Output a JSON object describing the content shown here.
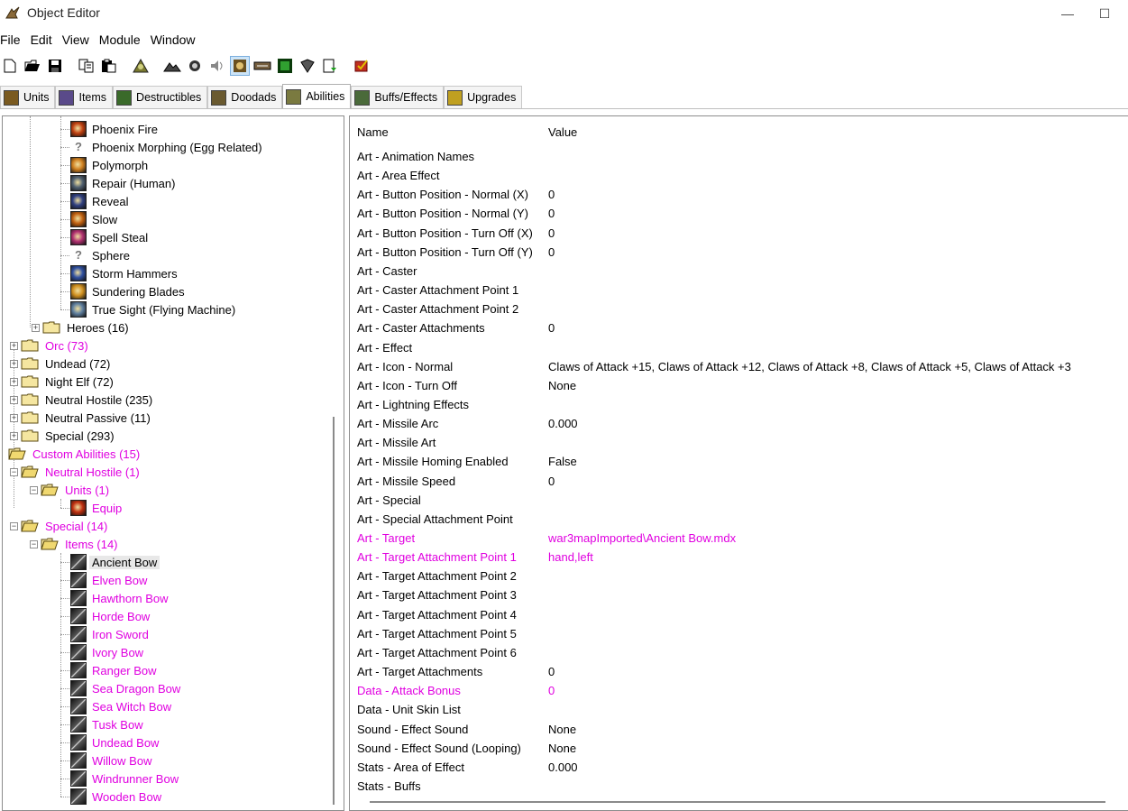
{
  "window": {
    "title": "Object Editor",
    "minimize": "—",
    "maximize": "☐"
  },
  "menu": [
    "File",
    "Edit",
    "View",
    "Module",
    "Window"
  ],
  "tabs": [
    {
      "label": "Units",
      "color": "#7a5a20"
    },
    {
      "label": "Items",
      "color": "#5a4a8a"
    },
    {
      "label": "Destructibles",
      "color": "#3a6a2a"
    },
    {
      "label": "Doodads",
      "color": "#6a5a30"
    },
    {
      "label": "Abilities",
      "color": "#7a7a40",
      "active": true
    },
    {
      "label": "Buffs/Effects",
      "color": "#4a6a3a"
    },
    {
      "label": "Upgrades",
      "color": "#c0a020"
    }
  ],
  "tree": {
    "human_leaves": [
      {
        "label": "Phoenix Fire",
        "icon": "#c04010"
      },
      {
        "label": "Phoenix Morphing (Egg Related)",
        "icon": "query"
      },
      {
        "label": "Polymorph",
        "icon": "#d08020"
      },
      {
        "label": "Repair (Human)",
        "icon": "#506070"
      },
      {
        "label": "Reveal",
        "icon": "#304080"
      },
      {
        "label": "Slow",
        "icon": "#c06010"
      },
      {
        "label": "Spell Steal",
        "icon": "#b03070"
      },
      {
        "label": "Sphere",
        "icon": "query"
      },
      {
        "label": "Storm Hammers",
        "icon": "#3050a0"
      },
      {
        "label": "Sundering Blades",
        "icon": "#d09020"
      },
      {
        "label": "True Sight (Flying Machine)",
        "icon": "#6080a0"
      }
    ],
    "heroes": "Heroes (16)",
    "races": [
      {
        "label": "Orc (73)",
        "modified": true
      },
      {
        "label": "Undead (72)",
        "modified": false
      },
      {
        "label": "Night Elf (72)",
        "modified": false
      },
      {
        "label": "Neutral Hostile (235)",
        "modified": false
      },
      {
        "label": "Neutral Passive (11)",
        "modified": false
      },
      {
        "label": "Special (293)",
        "modified": false
      }
    ],
    "custom_root": "Custom Abilities (15)",
    "custom_neutral": "Neutral Hostile (1)",
    "custom_units": "Units (1)",
    "custom_equip": "Equip",
    "custom_special": "Special (14)",
    "custom_items": "Items (14)",
    "items": [
      "Ancient Bow",
      "Elven Bow",
      "Hawthorn Bow",
      "Horde Bow",
      "Iron Sword",
      "Ivory Bow",
      "Ranger Bow",
      "Sea Dragon Bow",
      "Sea Witch Bow",
      "Tusk Bow",
      "Undead Bow",
      "Willow Bow",
      "Windrunner Bow",
      "Wooden Bow"
    ],
    "selected_item": "Ancient Bow"
  },
  "properties": {
    "header_name": "Name",
    "header_value": "Value",
    "rows": [
      {
        "name": "Art - Animation Names",
        "value": "",
        "modified": false
      },
      {
        "name": "Art - Area Effect",
        "value": "",
        "modified": false
      },
      {
        "name": "Art - Button Position - Normal (X)",
        "value": "0",
        "modified": false
      },
      {
        "name": "Art - Button Position - Normal (Y)",
        "value": "0",
        "modified": false
      },
      {
        "name": "Art - Button Position - Turn Off (X)",
        "value": "0",
        "modified": false
      },
      {
        "name": "Art - Button Position - Turn Off (Y)",
        "value": "0",
        "modified": false
      },
      {
        "name": "Art - Caster",
        "value": "",
        "modified": false
      },
      {
        "name": "Art - Caster Attachment Point 1",
        "value": "",
        "modified": false
      },
      {
        "name": "Art - Caster Attachment Point 2",
        "value": "",
        "modified": false
      },
      {
        "name": "Art - Caster Attachments",
        "value": "0",
        "modified": false
      },
      {
        "name": "Art - Effect",
        "value": "",
        "modified": false
      },
      {
        "name": "Art - Icon - Normal",
        "value": "Claws of Attack +15, Claws of Attack +12, Claws of Attack +8, Claws of Attack +5, Claws of Attack +3",
        "modified": false
      },
      {
        "name": "Art - Icon - Turn Off",
        "value": "None",
        "modified": false
      },
      {
        "name": "Art - Lightning Effects",
        "value": "",
        "modified": false
      },
      {
        "name": "Art - Missile Arc",
        "value": "0.000",
        "modified": false
      },
      {
        "name": "Art - Missile Art",
        "value": "",
        "modified": false
      },
      {
        "name": "Art - Missile Homing Enabled",
        "value": "False",
        "modified": false
      },
      {
        "name": "Art - Missile Speed",
        "value": "0",
        "modified": false
      },
      {
        "name": "Art - Special",
        "value": "",
        "modified": false
      },
      {
        "name": "Art - Special Attachment Point",
        "value": "",
        "modified": false
      },
      {
        "name": "Art - Target",
        "value": "war3mapImported\\Ancient Bow.mdx",
        "modified": true
      },
      {
        "name": "Art - Target Attachment Point 1",
        "value": "hand,left",
        "modified": true
      },
      {
        "name": "Art - Target Attachment Point 2",
        "value": "",
        "modified": false
      },
      {
        "name": "Art - Target Attachment Point 3",
        "value": "",
        "modified": false
      },
      {
        "name": "Art - Target Attachment Point 4",
        "value": "",
        "modified": false
      },
      {
        "name": "Art - Target Attachment Point 5",
        "value": "",
        "modified": false
      },
      {
        "name": "Art - Target Attachment Point 6",
        "value": "",
        "modified": false
      },
      {
        "name": "Art - Target Attachments",
        "value": "0",
        "modified": false
      },
      {
        "name": "Data - Attack Bonus",
        "value": "0",
        "modified": true
      },
      {
        "name": "Data - Unit Skin List",
        "value": "",
        "modified": false
      },
      {
        "name": "Sound - Effect Sound",
        "value": "None",
        "modified": false
      },
      {
        "name": "Sound - Effect Sound (Looping)",
        "value": "None",
        "modified": false
      },
      {
        "name": "Stats - Area of Effect",
        "value": "0.000",
        "modified": false
      },
      {
        "name": "Stats - Buffs",
        "value": "",
        "modified": false
      }
    ]
  },
  "colors": {
    "modified": "#e000e0",
    "selection": "#e8e8e8"
  }
}
